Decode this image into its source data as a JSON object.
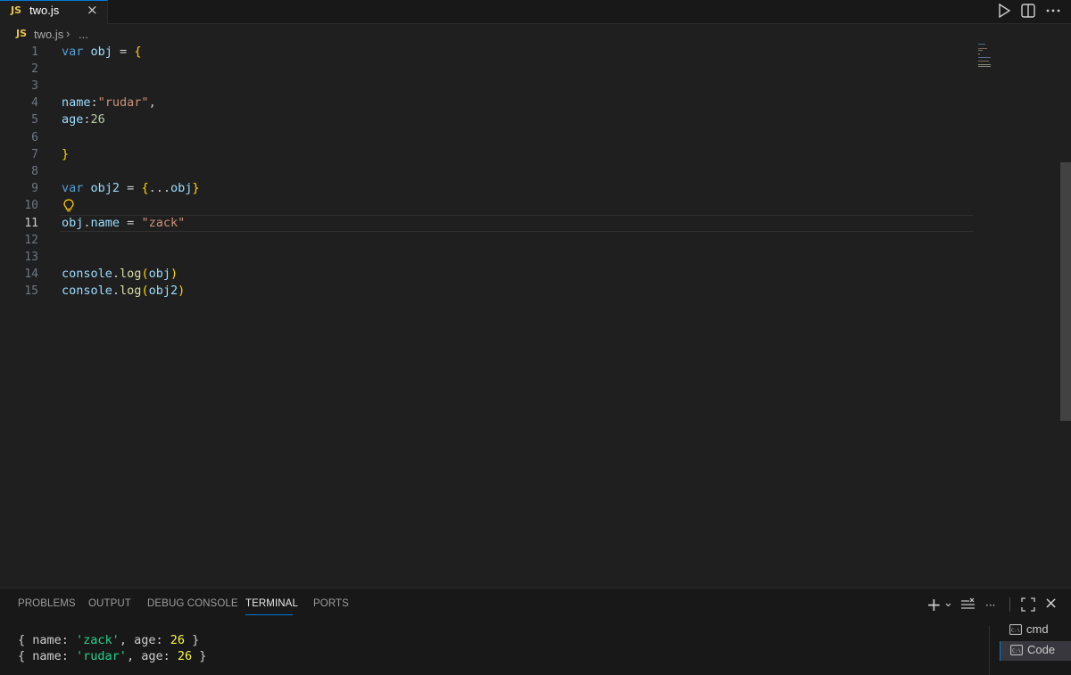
{
  "tab": {
    "icon_label": "JS",
    "file_name": "two.js",
    "close_glyph": "×"
  },
  "toolbar": {
    "run_icon": "play-icon",
    "split_icon": "split-editor-icon"
  },
  "breadcrumb": {
    "icon_label": "JS",
    "file": "two.js",
    "separator": "›",
    "more": "..."
  },
  "editor": {
    "active_line": 11,
    "lines": [
      {
        "n": "1",
        "tokens": [
          [
            "kw",
            "var"
          ],
          [
            "plain",
            " "
          ],
          [
            "var",
            "obj"
          ],
          [
            "plain",
            " = "
          ],
          [
            "brace",
            "{"
          ]
        ]
      },
      {
        "n": "2",
        "tokens": []
      },
      {
        "n": "3",
        "tokens": []
      },
      {
        "n": "4",
        "tokens": [
          [
            "var",
            "name"
          ],
          [
            "plain",
            ":"
          ],
          [
            "str",
            "\"rudar\""
          ],
          [
            "plain",
            ","
          ]
        ]
      },
      {
        "n": "5",
        "tokens": [
          [
            "var",
            "age"
          ],
          [
            "plain",
            ":"
          ],
          [
            "num",
            "26"
          ]
        ]
      },
      {
        "n": "6",
        "tokens": []
      },
      {
        "n": "7",
        "tokens": [
          [
            "brace",
            "}"
          ]
        ]
      },
      {
        "n": "8",
        "tokens": []
      },
      {
        "n": "9",
        "tokens": [
          [
            "kw",
            "var"
          ],
          [
            "plain",
            " "
          ],
          [
            "var",
            "obj2"
          ],
          [
            "plain",
            " = "
          ],
          [
            "brace",
            "{"
          ],
          [
            "plain",
            "..."
          ],
          [
            "var",
            "obj"
          ],
          [
            "brace",
            "}"
          ]
        ]
      },
      {
        "n": "10",
        "tokens": []
      },
      {
        "n": "11",
        "tokens": [
          [
            "var",
            "obj"
          ],
          [
            "plain",
            "."
          ],
          [
            "var",
            "name"
          ],
          [
            "plain",
            " = "
          ],
          [
            "str",
            "\"zack\""
          ]
        ]
      },
      {
        "n": "12",
        "tokens": []
      },
      {
        "n": "13",
        "tokens": []
      },
      {
        "n": "14",
        "tokens": [
          [
            "var",
            "console"
          ],
          [
            "plain",
            "."
          ],
          [
            "fn",
            "log"
          ],
          [
            "brace",
            "("
          ],
          [
            "var",
            "obj"
          ],
          [
            "brace",
            ")"
          ]
        ]
      },
      {
        "n": "15",
        "tokens": [
          [
            "var",
            "console"
          ],
          [
            "plain",
            "."
          ],
          [
            "fn",
            "log"
          ],
          [
            "brace",
            "("
          ],
          [
            "var",
            "obj2"
          ],
          [
            "brace",
            ")"
          ]
        ]
      }
    ]
  },
  "panel": {
    "tabs": [
      {
        "label": "PROBLEMS",
        "active": false
      },
      {
        "label": "OUTPUT",
        "active": false
      },
      {
        "label": "DEBUG CONSOLE",
        "active": false
      },
      {
        "label": "TERMINAL",
        "active": true
      },
      {
        "label": "PORTS",
        "active": false
      }
    ],
    "actions": {
      "new_terminal": "+",
      "dropdown": "⌄",
      "more": "···",
      "maximize": "⛶",
      "close": "×"
    },
    "terminal_output": [
      [
        [
          "plain",
          "{ name: "
        ],
        [
          "tstr",
          "'zack'"
        ],
        [
          "plain",
          ", age: "
        ],
        [
          "tnum",
          "26"
        ],
        [
          "plain",
          " }"
        ]
      ],
      [
        [
          "plain",
          "{ name: "
        ],
        [
          "tstr",
          "'rudar'"
        ],
        [
          "plain",
          ", age: "
        ],
        [
          "tnum",
          "26"
        ],
        [
          "plain",
          " }"
        ]
      ]
    ],
    "terminals": [
      {
        "label": "cmd",
        "active": false
      },
      {
        "label": "Code",
        "active": true
      }
    ]
  },
  "colors": {
    "accent": "#0078d4",
    "editor_bg": "#1f1f1f",
    "panel_bg": "#181818",
    "js_icon": "#e8c34b"
  }
}
